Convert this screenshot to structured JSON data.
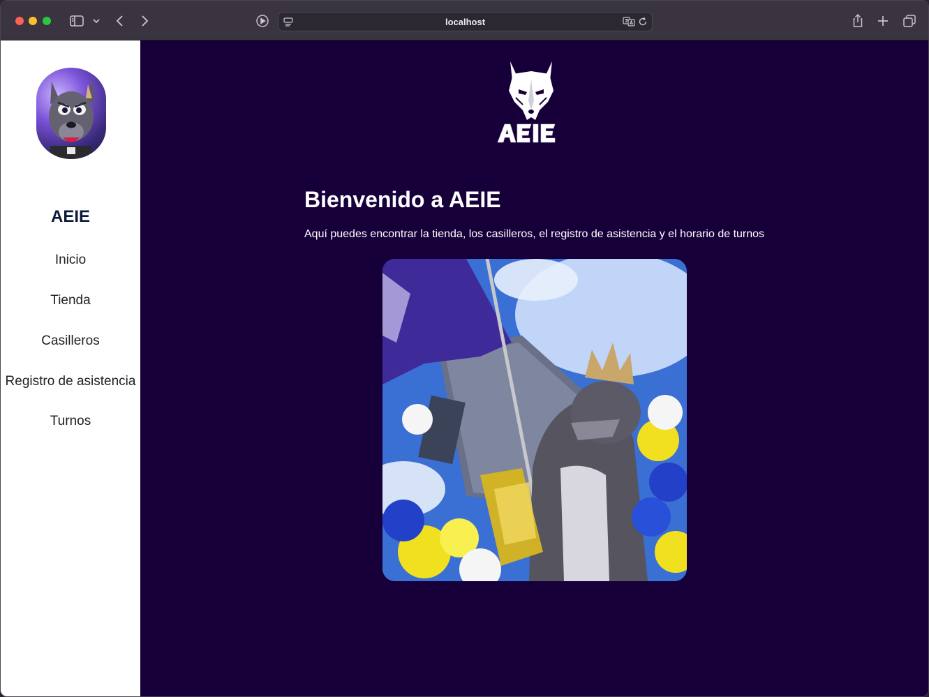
{
  "browser": {
    "url": "localhost",
    "icons": [
      "sidebar-toggle-icon",
      "chevron-down-icon",
      "back-icon",
      "forward-icon",
      "media-icon",
      "site-settings-icon",
      "translate-icon",
      "reload-icon",
      "share-icon",
      "new-tab-icon",
      "tab-overview-icon"
    ]
  },
  "sidebar": {
    "brand": "AEIE",
    "items": [
      {
        "label": "Inicio"
      },
      {
        "label": "Tienda"
      },
      {
        "label": "Casilleros"
      },
      {
        "label": "Registro de asistencia"
      },
      {
        "label": "Turnos"
      }
    ]
  },
  "main": {
    "logo_text": "AEIE",
    "title": "Bienvenido a AEIE",
    "subtitle": "Aquí puedes encontrar la tienda, los casilleros, el registro de asistencia y el horario de turnos"
  },
  "colors": {
    "background": "#17003a",
    "sidebar": "#ffffff",
    "brand": "#0b1a3a"
  }
}
